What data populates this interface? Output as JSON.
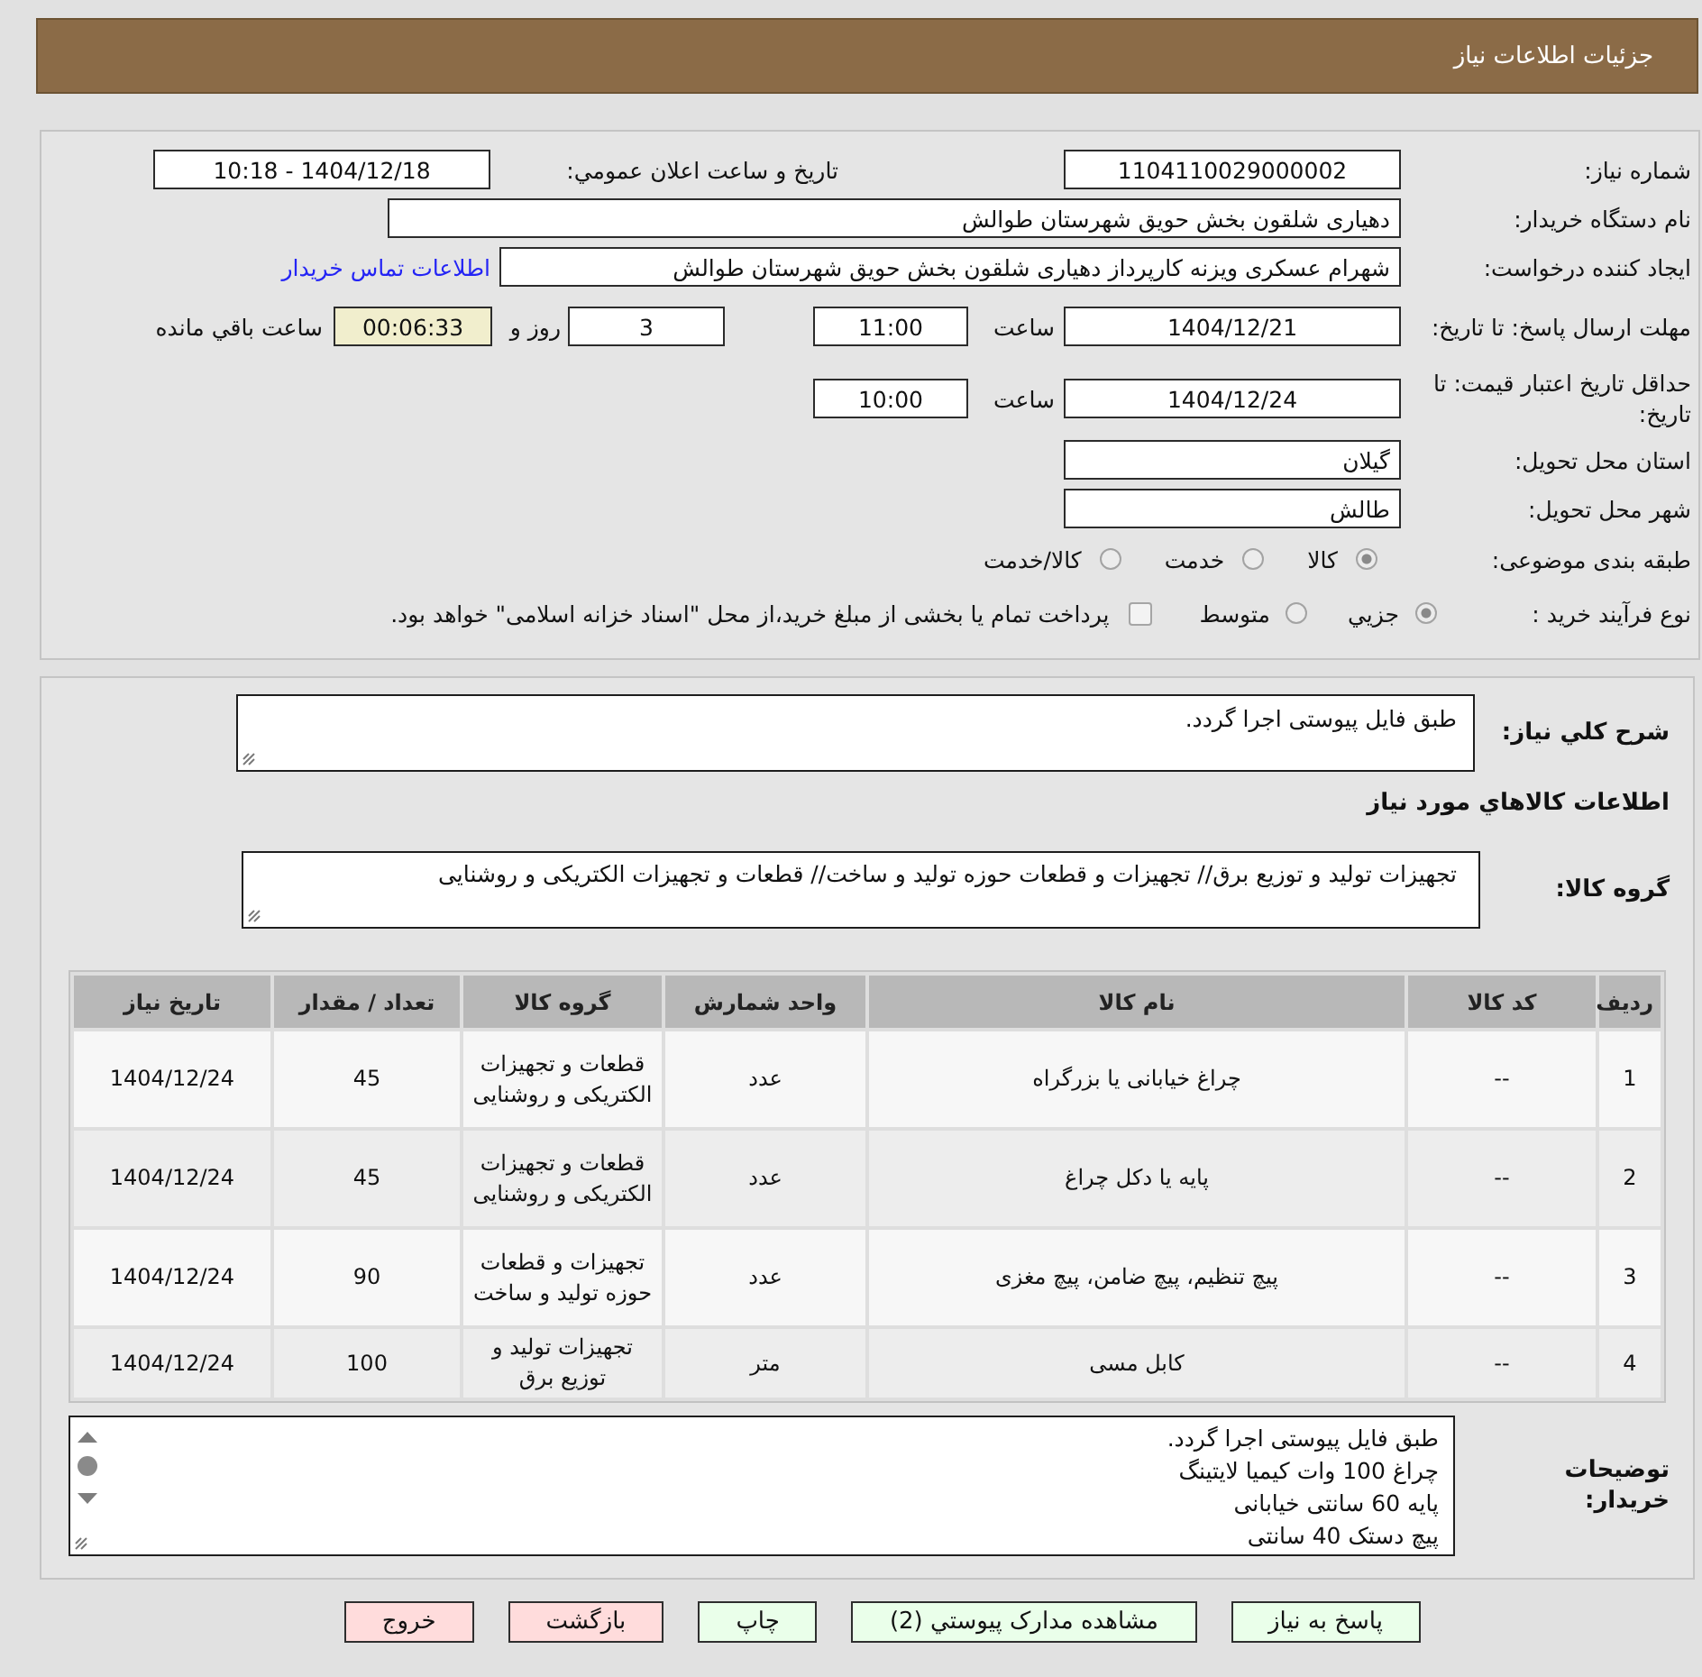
{
  "header": {
    "title": "جزئیات اطلاعات نیاز"
  },
  "details": {
    "need_number": {
      "label": "شماره نیاز:",
      "value": "1104110029000002"
    },
    "announcement": {
      "label": "تاريخ و ساعت اعلان عمومي:",
      "value": "1404/12/18 - 10:18"
    },
    "buyer_org": {
      "label": "نام دستگاه خريدار:",
      "value": "دهیاری شلقون بخش حویق شهرستان طوالش"
    },
    "requester": {
      "label": "ایجاد کننده درخواست:",
      "value": "شهرام عسکری ویزنه کارپرداز دهیاری شلقون بخش حویق شهرستان طوالش",
      "contact_link": "اطلاعات تماس خریدار"
    },
    "reply_deadline": {
      "label": "مهلت ارسال پاسخ: تا تاریخ:",
      "date": "1404/12/21",
      "time_label": "ساعت",
      "time": "11:00",
      "days": "3",
      "days_label": "روز و",
      "remaining": "00:06:33",
      "remaining_label": "ساعت باقي مانده"
    },
    "price_validity": {
      "label": "حداقل تاریخ اعتبار قیمت: تا تاریخ:",
      "date": "1404/12/24",
      "time_label": "ساعت",
      "time": "10:00"
    },
    "delivery_province": {
      "label": "استان محل تحویل:",
      "value": "گیلان"
    },
    "delivery_city": {
      "label": "شهر محل تحویل:",
      "value": "طالش"
    },
    "subject_category": {
      "label": "طبقه بندی موضوعی:",
      "options": [
        {
          "label": "کالا",
          "selected": true
        },
        {
          "label": "خدمت",
          "selected": false
        },
        {
          "label": "کالا/خدمت",
          "selected": false
        }
      ]
    },
    "purchase_process": {
      "label": "نوع فرآیند خرید :",
      "options": [
        {
          "label": "جزيي",
          "selected": true
        },
        {
          "label": "متوسط",
          "selected": false
        }
      ],
      "treasury_payment": {
        "label": "پرداخت تمام یا بخشی از مبلغ خرید،از محل \"اسناد خزانه اسلامی\" خواهد بود.",
        "checked": false
      }
    }
  },
  "items": {
    "description": {
      "label": "شرح کلي نياز:",
      "value": "طبق فایل پیوستی اجرا گردد."
    },
    "goods_title": "اطلاعات کالاهاي مورد نياز",
    "goods_group": {
      "label": "گروه کالا:",
      "value": "تجهیزات تولید و توزیع برق// تجهیزات و قطعات حوزه تولید و ساخت// قطعات و تجهیزات الکتریکی و روشنایی"
    },
    "table": {
      "columns": [
        "ردیف",
        "کد کالا",
        "نام کالا",
        "واحد شمارش",
        "گروه کالا",
        "تعداد / مقدار",
        "تاریخ نیاز"
      ],
      "rows": [
        [
          "1",
          "--",
          "چراغ خیابانی یا بزرگراه",
          "عدد",
          "قطعات و تجهیزات الکتریکی و روشنایی",
          "45",
          "1404/12/24"
        ],
        [
          "2",
          "--",
          "پایه یا دکل چراغ",
          "عدد",
          "قطعات و تجهیزات الکتریکی و روشنایی",
          "45",
          "1404/12/24"
        ],
        [
          "3",
          "--",
          "پیچ تنظیم، پیچ ضامن، پیچ مغزی",
          "عدد",
          "تجهیزات و قطعات حوزه تولید و ساخت",
          "90",
          "1404/12/24"
        ],
        [
          "4",
          "--",
          "کابل مسی",
          "متر",
          "تجهیزات تولید و توزیع برق",
          "100",
          "1404/12/24"
        ]
      ]
    },
    "buyer_notes": {
      "label": "توضیحات خریدار:",
      "lines": [
        "طبق فایل پیوستی اجرا گردد.",
        "چراغ 100 وات کیمیا لایتینگ",
        "پایه 60 سانتی خیابانی",
        "پیچ دستک 40 سانتی"
      ]
    }
  },
  "buttons": [
    {
      "label": "پاسخ به نیاز",
      "kind": "confirm"
    },
    {
      "label": "مشاهده مدارک پیوستي (2)",
      "kind": "confirm"
    },
    {
      "label": "چاپ",
      "kind": "confirm"
    },
    {
      "label": "بازگشت",
      "kind": "cancel"
    },
    {
      "label": "خروج",
      "kind": "cancel"
    }
  ]
}
